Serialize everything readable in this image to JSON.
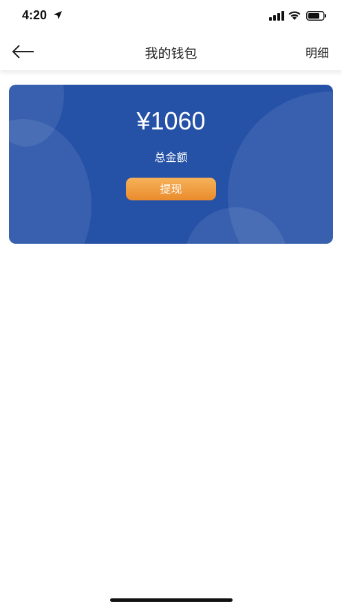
{
  "status_bar": {
    "time": "4:20"
  },
  "nav": {
    "title": "我的钱包",
    "detail_label": "明细"
  },
  "wallet": {
    "amount": "¥1060",
    "amount_label": "总金额",
    "withdraw_label": "提现"
  },
  "colors": {
    "card_background": "#2551a6",
    "button_gradient_top": "#f6b25a",
    "button_gradient_bottom": "#ea8b2c"
  },
  "icons": [
    "location-arrow-icon",
    "cellular-signal-icon",
    "wifi-icon",
    "battery-icon",
    "back-arrow-icon"
  ]
}
